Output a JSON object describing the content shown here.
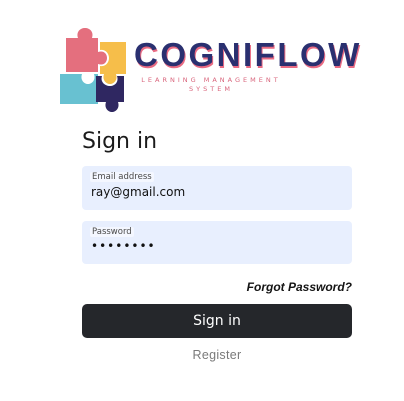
{
  "brand": {
    "name": "COGNIFLOW",
    "tagline": "LEARNING MANAGEMENT SYSTEM",
    "colors": {
      "puzzle_red": "#e46f7e",
      "puzzle_yellow": "#f6be4a",
      "puzzle_teal": "#68c1d1",
      "puzzle_navy": "#2f2761",
      "brand_text": "#2a3070",
      "brand_shadow": "#e96b83"
    }
  },
  "form": {
    "title": "Sign in",
    "email": {
      "label": "Email address",
      "value": "ray@gmail.com"
    },
    "password": {
      "label": "Password",
      "value": "••••••••"
    },
    "forgot_label": "Forgot Password?",
    "submit_label": "Sign in",
    "register_label": "Register"
  },
  "colors": {
    "input_bg": "#e8effe",
    "button_bg": "#25272b"
  }
}
